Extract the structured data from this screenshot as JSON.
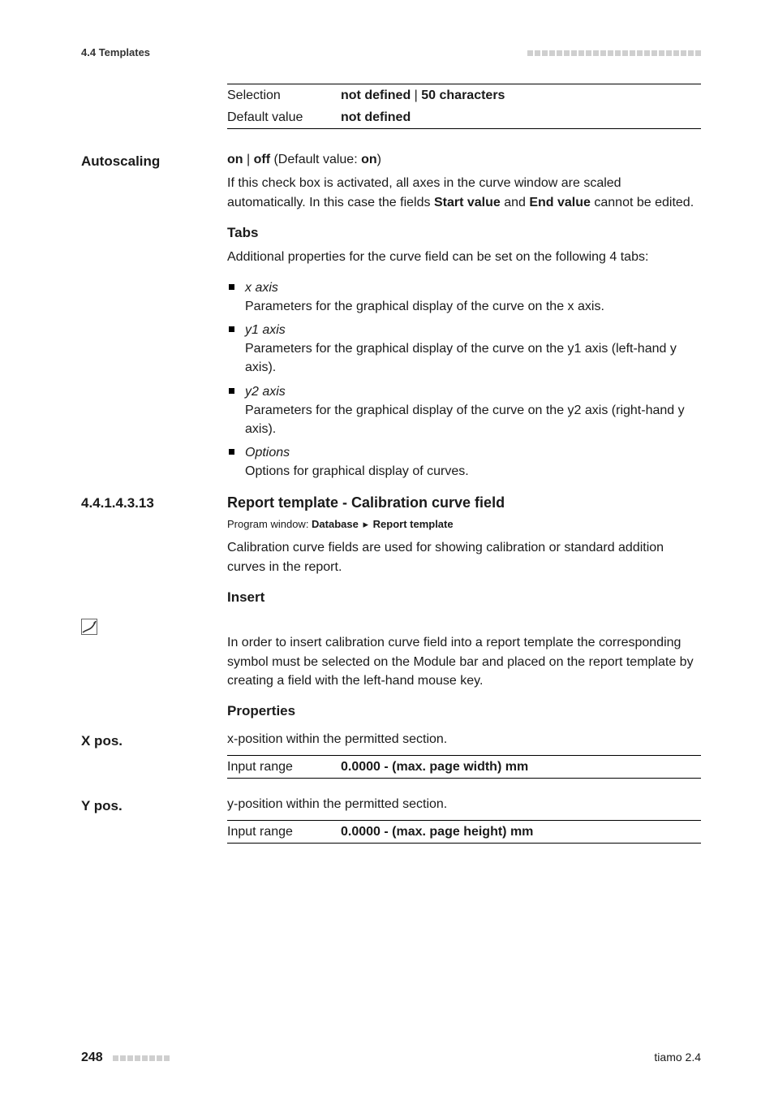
{
  "header": {
    "section_number": "4.4",
    "section_title": "Templates"
  },
  "top_definition": {
    "rows": [
      {
        "key": "Selection",
        "value_strong": "not defined",
        "value_sep": " | ",
        "value_rest": "50 characters"
      },
      {
        "key": "Default value",
        "value_strong": "not defined",
        "value_sep": "",
        "value_rest": ""
      }
    ]
  },
  "autoscaling": {
    "label": "Autoscaling",
    "toggle_line": {
      "on": "on",
      "sep1": " | ",
      "off": "off",
      "paren_open": " (Default value: ",
      "default": "on",
      "paren_close": ")"
    },
    "description_parts": {
      "p1": "If this check box is activated, all axes in the curve window are scaled automatically. In this case the fields ",
      "b1": "Start value",
      "p2": " and ",
      "b2": "End value",
      "p3": " cannot be edited."
    }
  },
  "tabs": {
    "heading": "Tabs",
    "intro": "Additional properties for the curve field can be set on the following 4 tabs:",
    "items": [
      {
        "term": "x axis",
        "desc": "Parameters for the graphical display of the curve on the x axis."
      },
      {
        "term": "y1 axis",
        "desc": "Parameters for the graphical display of the curve on the y1 axis (left-hand y axis)."
      },
      {
        "term": "y2 axis",
        "desc": "Parameters for the graphical display of the curve on the y2 axis (right-hand y axis)."
      },
      {
        "term": "Options",
        "desc": "Options for graphical display of curves."
      }
    ]
  },
  "section": {
    "number": "4.4.1.4.3.13",
    "title": "Report template - Calibration curve field",
    "breadcrumb": {
      "label": "Program window: ",
      "part1": "Database",
      "sep": "▸",
      "part2": "Report template"
    },
    "intro": "Calibration curve fields are used for showing calibration or standard addition curves in the report.",
    "insert": {
      "heading": "Insert",
      "icon_name": "calibration-curve-icon",
      "body": "In order to insert calibration curve field into a report template the corresponding symbol must be selected on the Module bar and placed on the report template by creating a field with the left-hand mouse key."
    },
    "properties": {
      "heading": "Properties",
      "xpos": {
        "label": "X pos.",
        "desc": "x-position within the permitted section.",
        "row": {
          "key": "Input range",
          "value": "0.0000 - (max. page width) mm"
        }
      },
      "ypos": {
        "label": "Y pos.",
        "desc": "y-position within the permitted section.",
        "row": {
          "key": "Input range",
          "value": "0.0000 - (max. page height) mm"
        }
      }
    }
  },
  "footer": {
    "page_number": "248",
    "doc_title": "tiamo 2.4"
  }
}
